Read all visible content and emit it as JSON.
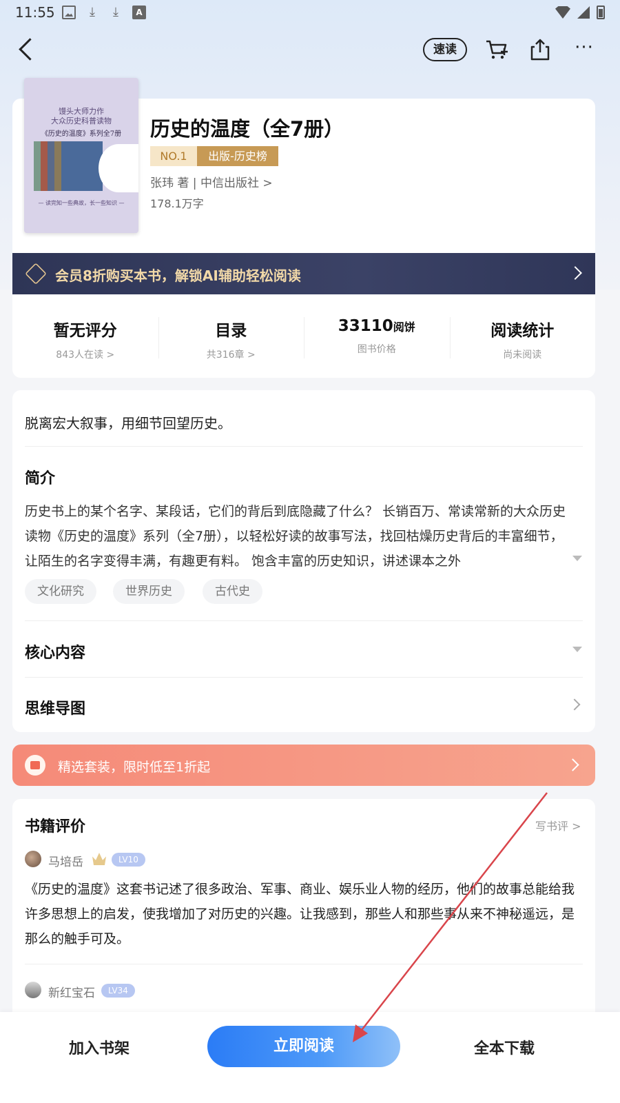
{
  "status_bar": {
    "time": "11:55"
  },
  "nav": {
    "speed_read": "速读"
  },
  "book": {
    "title": "历史的温度（全7册）",
    "rank_no": "NO.1",
    "rank_list": "出版-历史榜",
    "author_line": "张玮 著 | 中信出版社 >",
    "word_count": "178.1万字",
    "cover": {
      "line1": "馒头大师力作",
      "line2": "大众历史科普读物",
      "line3": "《历史的温度》系列全7册",
      "bottom": "— 读完知一些典故，长一些知识 —"
    }
  },
  "vip_banner": {
    "text": "会员8折购买本书，解锁AI辅助轻松阅读"
  },
  "stats": [
    {
      "main": "暂无评分",
      "unit": "",
      "sub": "843人在读 >"
    },
    {
      "main": "目录",
      "unit": "",
      "sub": "共316章 >"
    },
    {
      "main": "33110",
      "unit": "阅饼",
      "sub": "图书价格"
    },
    {
      "main": "阅读统计",
      "unit": "",
      "sub": "尚未阅读"
    }
  ],
  "detail": {
    "tagline": "脱离宏大叙事，用细节回望历史。",
    "intro_title": "简介",
    "intro_text": "历史书上的某个名字、某段话，它们的背后到底隐藏了什么？ 长销百万、常读常新的大众历史读物《历史的温度》系列（全7册），以轻松好读的故事写法，找回枯燥历史背后的丰富细节，让陌生的名字变得丰满，有趣更有料。 饱含丰富的历史知识，讲述课本之外",
    "tags": [
      "文化研究",
      "世界历史",
      "古代史"
    ],
    "core_title": "核心内容",
    "mindmap_title": "思维导图"
  },
  "promo": {
    "text": "精选套装，限时低至1折起"
  },
  "reviews": {
    "title": "书籍评价",
    "write": "写书评 >",
    "items": [
      {
        "user": "马培岳",
        "level": "LV10",
        "text": "《历史的温度》这套书记述了很多政治、军事、商业、娱乐业人物的经历，他们的故事总能给我许多思想上的启发，使我增加了对历史的兴趣。让我感到，那些人和那些事从来不神秘遥远，是那么的触手可及。"
      },
      {
        "user": "新红宝石",
        "level": "LV34",
        "text": ""
      }
    ]
  },
  "bottom": {
    "add_shelf": "加入书架",
    "read_now": "立即阅读",
    "download": "全本下载"
  },
  "colors": {
    "accent_blue": "#2b7cf6",
    "gold": "#c79a55",
    "vip_navy": "#2e3556",
    "promo_coral": "#f58a78",
    "annotation_arrow": "#d9454b"
  },
  "icons": [
    "image-icon",
    "download-icon",
    "a-icon",
    "wifi-icon",
    "signal-icon",
    "battery-icon",
    "back-icon",
    "cart-icon",
    "share-icon",
    "more-icon",
    "vip-icon",
    "gift-icon",
    "crown-icon"
  ]
}
